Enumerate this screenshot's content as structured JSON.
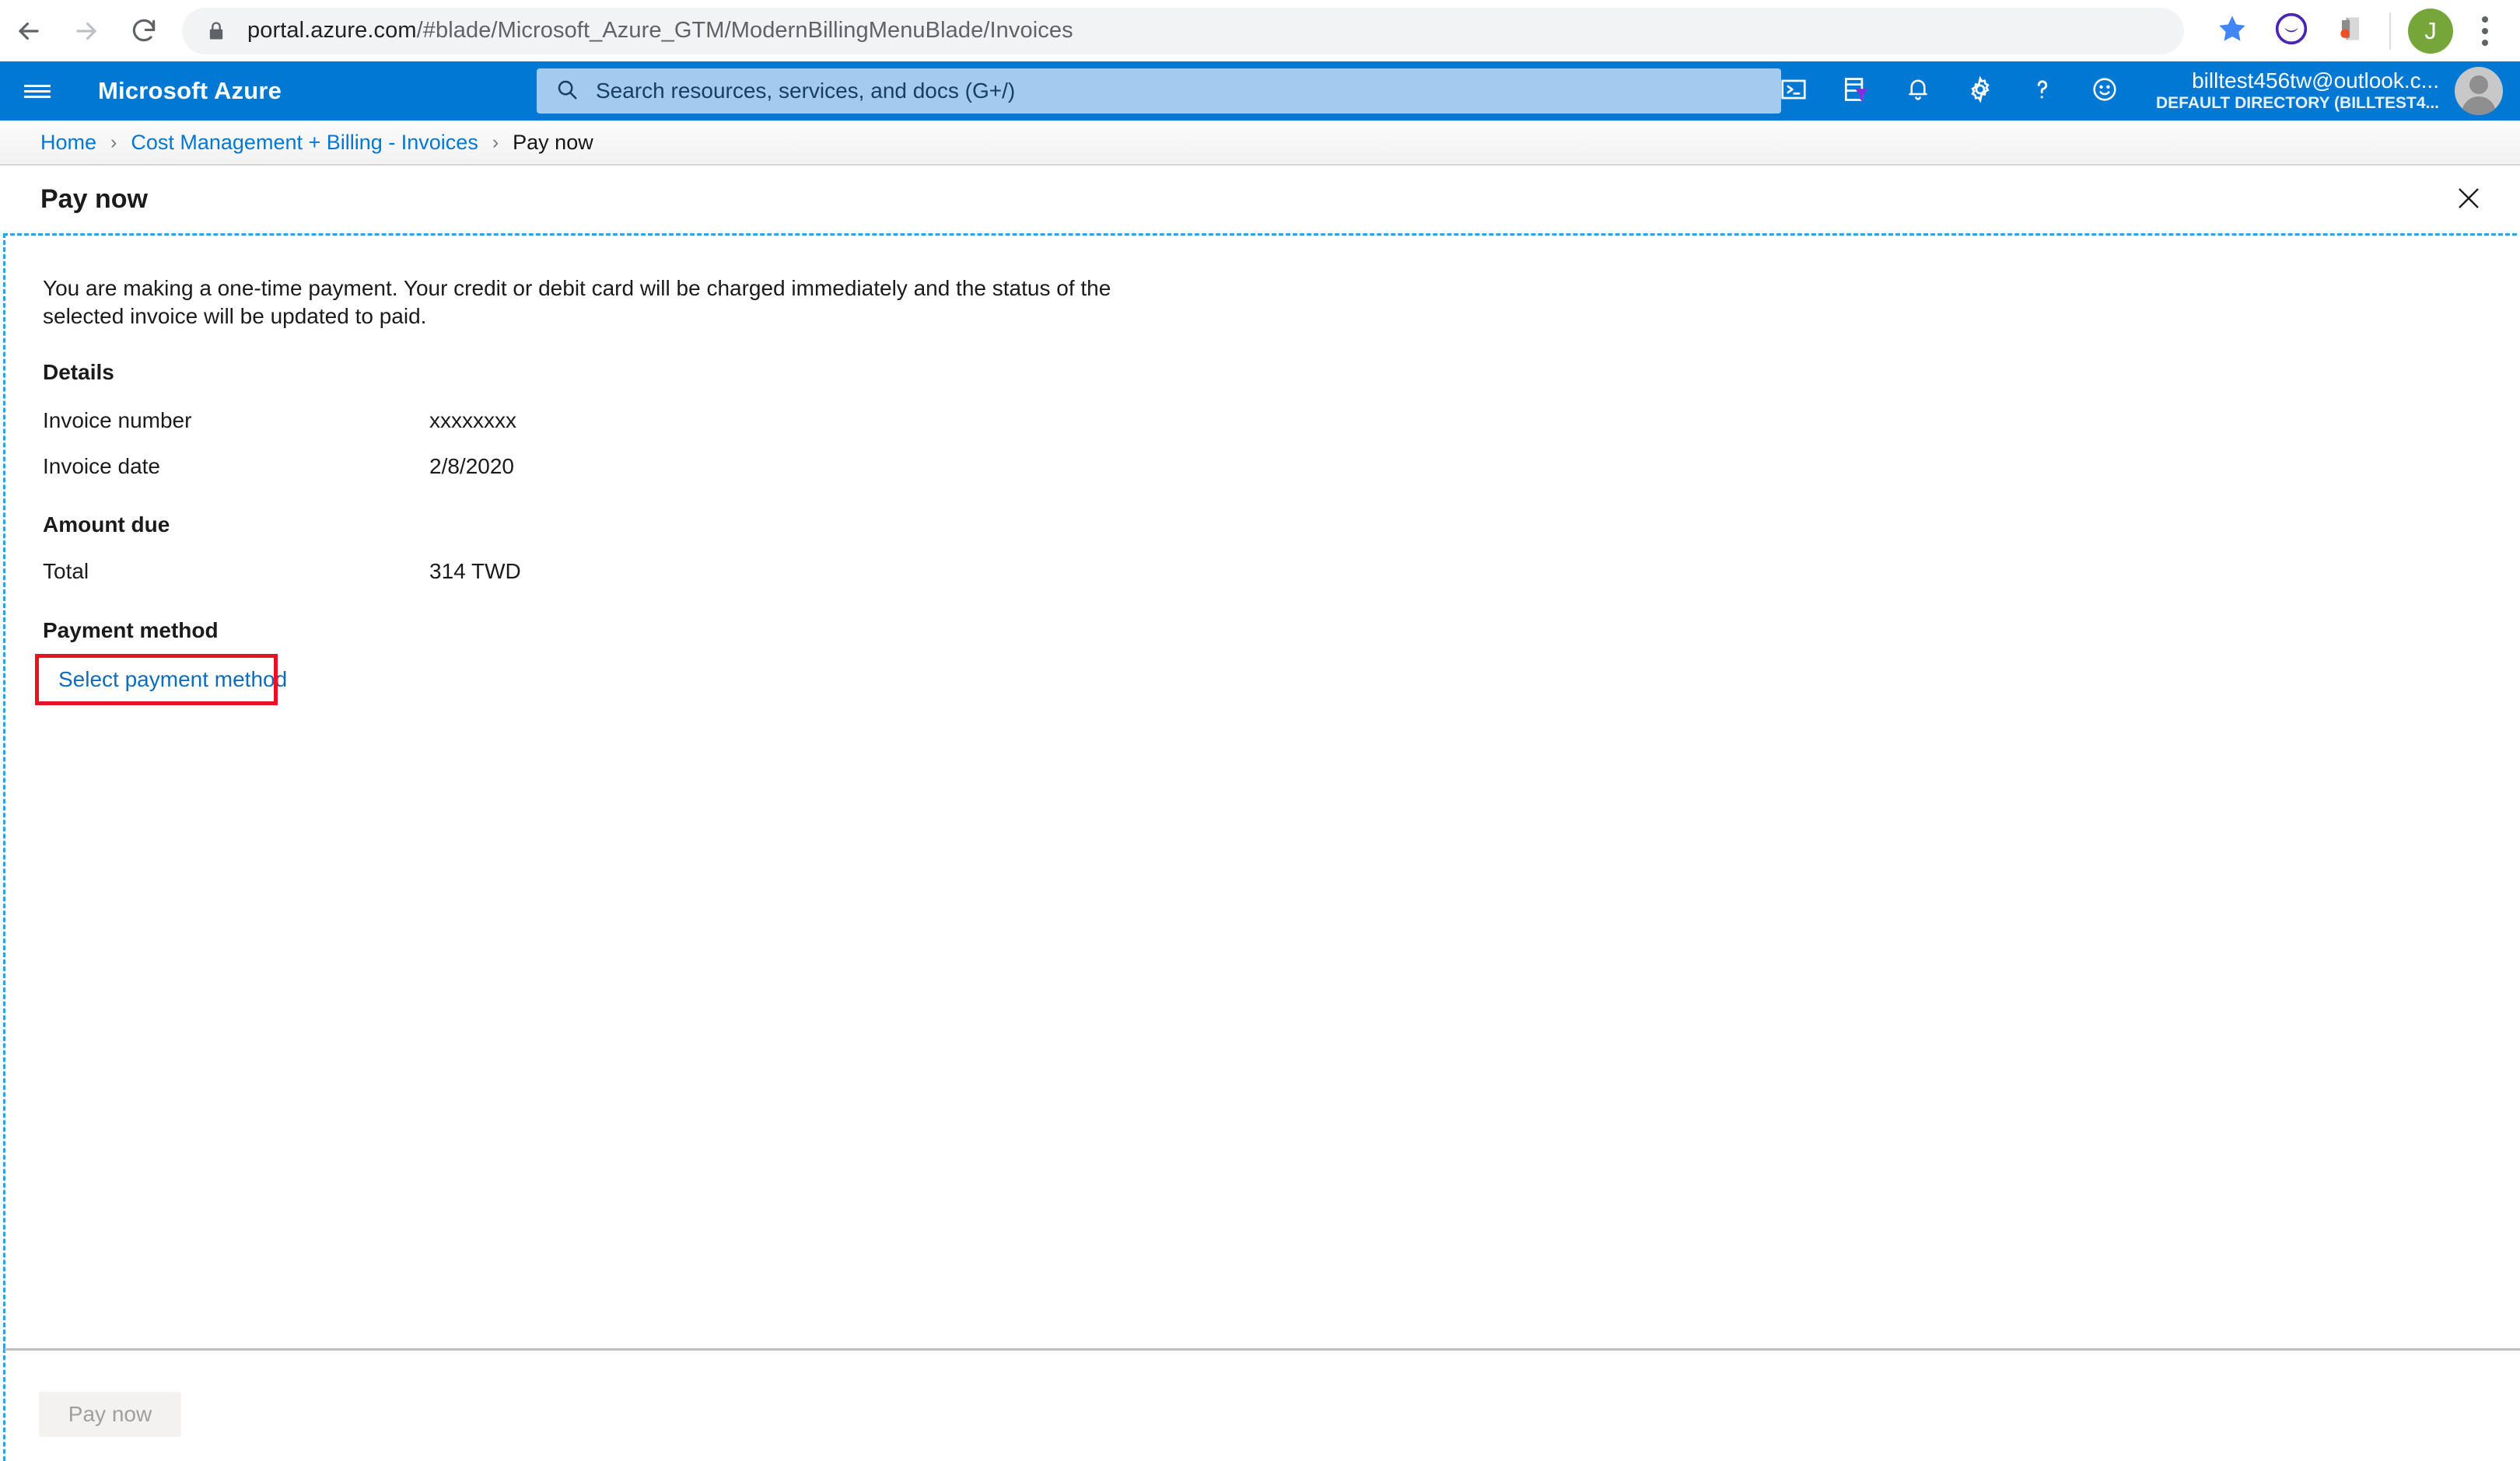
{
  "browser": {
    "back_icon": "back-arrow-icon",
    "forward_icon": "forward-arrow-icon",
    "reload_icon": "reload-icon",
    "lock_icon": "lock-icon",
    "url_host": "portal.azure.com",
    "url_path": "/#blade/Microsoft_Azure_GTM/ModernBillingMenuBlade/Invoices",
    "bookmark_icon": "star-icon",
    "extension_one_icon": "moon-circle-icon",
    "extension_two_icon": "puzzle-extension-icon",
    "profile_initial": "J",
    "menu_icon": "three-dot-menu-icon",
    "colors": {
      "bookmark_star": "#4285f4",
      "extension_purple": "#4b23b5",
      "extension_orange": "#f04e23",
      "profile_green": "#76a53a"
    }
  },
  "azure_header": {
    "hamburger_icon": "hamburger-menu-icon",
    "brand": "Microsoft Azure",
    "search_placeholder": "Search resources, services, and docs (G+/)",
    "search_icon": "search-icon",
    "icons": [
      {
        "name": "cloud-shell-icon",
        "label": "Cloud Shell"
      },
      {
        "name": "directory-filter-icon",
        "label": "Directories + subscriptions"
      },
      {
        "name": "notifications-bell-icon",
        "label": "Notifications"
      },
      {
        "name": "settings-gear-icon",
        "label": "Settings"
      },
      {
        "name": "help-question-icon",
        "label": "Help"
      },
      {
        "name": "feedback-smiley-icon",
        "label": "Feedback"
      }
    ],
    "account_name": "billtest456tw@outlook.c...",
    "account_directory": "DEFAULT DIRECTORY (BILLTEST4...",
    "avatar_icon": "user-avatar-icon",
    "bar_color": "#0078d4"
  },
  "breadcrumb": {
    "items": [
      {
        "label": "Home",
        "current": false
      },
      {
        "label": "Cost Management + Billing - Invoices",
        "current": false
      },
      {
        "label": "Pay now",
        "current": true
      }
    ],
    "separator": "›",
    "link_color": "#0078d4"
  },
  "blade": {
    "title": "Pay now",
    "close_icon": "close-x-icon",
    "intro": "You are making a one-time payment. Your credit or debit card will be charged immediately and the status of the selected invoice will be updated to paid.",
    "sections": {
      "details": {
        "heading": "Details",
        "rows": [
          {
            "label": "Invoice number",
            "value": "xxxxxxxx"
          },
          {
            "label": "Invoice date",
            "value": "2/8/2020"
          }
        ]
      },
      "amount_due": {
        "heading": "Amount due",
        "rows": [
          {
            "label": "Total",
            "value": "314 TWD"
          }
        ]
      },
      "payment_method": {
        "heading": "Payment method",
        "select_link": "Select payment method",
        "link_color": "#0f6cbd",
        "highlight_color": "#e81123"
      }
    },
    "footer": {
      "submit_label": "Pay now",
      "submit_disabled": true,
      "disabled_bg": "#f3f2f1",
      "disabled_text": "#a19f9d"
    }
  }
}
